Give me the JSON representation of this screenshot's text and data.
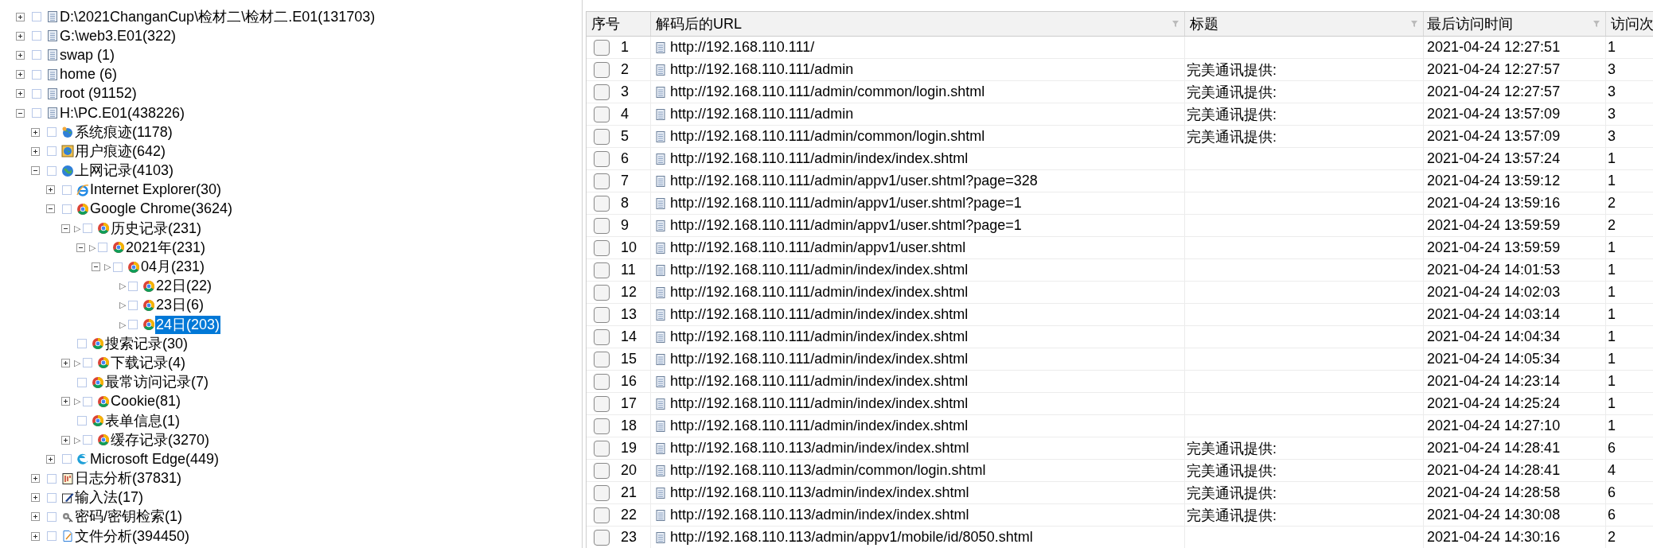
{
  "tree": {
    "items": [
      {
        "label": "D:\\2021ChanganCup\\检材二\\检材二.E01(131703)",
        "kind": "disk",
        "expanded": false,
        "checked": false,
        "selected": false
      },
      {
        "label": "G:\\web3.E01(322)",
        "kind": "disk",
        "expanded": false,
        "checked": false,
        "selected": false
      },
      {
        "label": "swap (1)",
        "kind": "disk",
        "expanded": false,
        "checked": false,
        "selected": false
      },
      {
        "label": "home (6)",
        "kind": "disk",
        "expanded": false,
        "checked": false,
        "selected": false
      },
      {
        "label": "root (91152)",
        "kind": "disk",
        "expanded": false,
        "checked": false,
        "selected": false
      },
      {
        "label": "H:\\PC.E01(438226)",
        "kind": "disk",
        "expanded": true,
        "checked": false,
        "selected": false,
        "children": [
          {
            "label": "系统痕迹(1178)",
            "kind": "system",
            "expanded": false,
            "checked": false,
            "selected": false
          },
          {
            "label": "用户痕迹(642)",
            "kind": "user",
            "expanded": false,
            "checked": false,
            "selected": false
          },
          {
            "label": "上网记录(4103)",
            "kind": "globe",
            "expanded": true,
            "checked": false,
            "selected": false,
            "children": [
              {
                "label": "Internet Explorer(30)",
                "kind": "ie",
                "expanded": false,
                "checked": false,
                "selected": false
              },
              {
                "label": "Google Chrome(3624)",
                "kind": "chrome",
                "expanded": true,
                "checked": false,
                "selected": false,
                "children": [
                  {
                    "label": "历史记录(231)",
                    "kind": "chrome",
                    "expanded": true,
                    "marker": "▷",
                    "checked": false,
                    "selected": false,
                    "children": [
                      {
                        "label": "2021年(231)",
                        "kind": "chrome",
                        "expanded": true,
                        "marker": "▷",
                        "checked": false,
                        "selected": false,
                        "children": [
                          {
                            "label": "04月(231)",
                            "kind": "chrome",
                            "expanded": true,
                            "marker": "▷",
                            "checked": false,
                            "selected": false,
                            "children": [
                              {
                                "label": "22日(22)",
                                "kind": "chrome",
                                "marker": "▷",
                                "checked": false,
                                "selected": false
                              },
                              {
                                "label": "23日(6)",
                                "kind": "chrome",
                                "marker": "▷",
                                "checked": false,
                                "selected": false
                              },
                              {
                                "label": "24日(203)",
                                "kind": "chrome",
                                "marker": "▷",
                                "checked": false,
                                "selected": true
                              }
                            ]
                          }
                        ]
                      }
                    ]
                  },
                  {
                    "label": "搜索记录(30)",
                    "kind": "chrome",
                    "checked": false,
                    "selected": false
                  },
                  {
                    "label": "下载记录(4)",
                    "kind": "chrome",
                    "expanded": false,
                    "marker": "▷",
                    "checked": false,
                    "selected": false
                  },
                  {
                    "label": "最常访问记录(7)",
                    "kind": "chrome",
                    "checked": false,
                    "selected": false
                  },
                  {
                    "label": "Cookie(81)",
                    "kind": "chrome",
                    "expanded": false,
                    "marker": "▷",
                    "checked": false,
                    "selected": false
                  },
                  {
                    "label": "表单信息(1)",
                    "kind": "chrome",
                    "checked": false,
                    "selected": false
                  },
                  {
                    "label": "缓存记录(3270)",
                    "kind": "chrome",
                    "expanded": false,
                    "marker": "▷",
                    "checked": false,
                    "selected": false
                  }
                ]
              },
              {
                "label": "Microsoft Edge(449)",
                "kind": "edge",
                "expanded": false,
                "checked": false,
                "selected": false
              }
            ]
          },
          {
            "label": "日志分析(37831)",
            "kind": "log",
            "expanded": false,
            "checked": false,
            "selected": false
          },
          {
            "label": "输入法(17)",
            "kind": "ime",
            "expanded": false,
            "checked": false,
            "selected": false
          },
          {
            "label": "密码/密钥检索(1)",
            "kind": "key",
            "expanded": false,
            "checked": false,
            "selected": false
          },
          {
            "label": "文件分析(394450)",
            "kind": "file",
            "expanded": false,
            "checked": false,
            "selected": false
          }
        ]
      }
    ]
  },
  "table": {
    "columns": [
      {
        "label": "序号",
        "filter": false
      },
      {
        "label": "解码后的URL",
        "filter": true
      },
      {
        "label": "标题",
        "filter": true
      },
      {
        "label": "最后访问时间",
        "filter": true
      },
      {
        "label": "访问次"
      }
    ],
    "rows": [
      {
        "checked": false,
        "no": "1",
        "url": "http://192.168.110.111/",
        "title": "",
        "time": "2021-04-24 12:27:51",
        "count": "1"
      },
      {
        "checked": false,
        "no": "2",
        "url": "http://192.168.110.111/admin",
        "title": "完美通讯提供:",
        "time": "2021-04-24 12:27:57",
        "count": "3"
      },
      {
        "checked": false,
        "no": "3",
        "url": "http://192.168.110.111/admin/common/login.shtml",
        "title": "完美通讯提供:",
        "time": "2021-04-24 12:27:57",
        "count": "3"
      },
      {
        "checked": false,
        "no": "4",
        "url": "http://192.168.110.111/admin",
        "title": "完美通讯提供:",
        "time": "2021-04-24 13:57:09",
        "count": "3"
      },
      {
        "checked": false,
        "no": "5",
        "url": "http://192.168.110.111/admin/common/login.shtml",
        "title": "完美通讯提供:",
        "time": "2021-04-24 13:57:09",
        "count": "3"
      },
      {
        "checked": false,
        "no": "6",
        "url": "http://192.168.110.111/admin/index/index.shtml",
        "title": "",
        "time": "2021-04-24 13:57:24",
        "count": "1"
      },
      {
        "checked": false,
        "no": "7",
        "url": "http://192.168.110.111/admin/appv1/user.shtml?page=328",
        "title": "",
        "time": "2021-04-24 13:59:12",
        "count": "1"
      },
      {
        "checked": false,
        "no": "8",
        "url": "http://192.168.110.111/admin/appv1/user.shtml?page=1",
        "title": "",
        "time": "2021-04-24 13:59:16",
        "count": "2"
      },
      {
        "checked": false,
        "no": "9",
        "url": "http://192.168.110.111/admin/appv1/user.shtml?page=1",
        "title": "",
        "time": "2021-04-24 13:59:59",
        "count": "2"
      },
      {
        "checked": false,
        "no": "10",
        "url": "http://192.168.110.111/admin/appv1/user.shtml",
        "title": "",
        "time": "2021-04-24 13:59:59",
        "count": "1"
      },
      {
        "checked": false,
        "no": "11",
        "url": "http://192.168.110.111/admin/index/index.shtml",
        "title": "",
        "time": "2021-04-24 14:01:53",
        "count": "1"
      },
      {
        "checked": false,
        "no": "12",
        "url": "http://192.168.110.111/admin/index/index.shtml",
        "title": "",
        "time": "2021-04-24 14:02:03",
        "count": "1"
      },
      {
        "checked": false,
        "no": "13",
        "url": "http://192.168.110.111/admin/index/index.shtml",
        "title": "",
        "time": "2021-04-24 14:03:14",
        "count": "1"
      },
      {
        "checked": false,
        "no": "14",
        "url": "http://192.168.110.111/admin/index/index.shtml",
        "title": "",
        "time": "2021-04-24 14:04:34",
        "count": "1"
      },
      {
        "checked": false,
        "no": "15",
        "url": "http://192.168.110.111/admin/index/index.shtml",
        "title": "",
        "time": "2021-04-24 14:05:34",
        "count": "1"
      },
      {
        "checked": false,
        "no": "16",
        "url": "http://192.168.110.111/admin/index/index.shtml",
        "title": "",
        "time": "2021-04-24 14:23:14",
        "count": "1"
      },
      {
        "checked": false,
        "no": "17",
        "url": "http://192.168.110.111/admin/index/index.shtml",
        "title": "",
        "time": "2021-04-24 14:25:24",
        "count": "1"
      },
      {
        "checked": false,
        "no": "18",
        "url": "http://192.168.110.111/admin/index/index.shtml",
        "title": "",
        "time": "2021-04-24 14:27:10",
        "count": "1"
      },
      {
        "checked": false,
        "no": "19",
        "url": "http://192.168.110.113/admin/index/index.shtml",
        "title": "完美通讯提供:",
        "time": "2021-04-24 14:28:41",
        "count": "6"
      },
      {
        "checked": false,
        "no": "20",
        "url": "http://192.168.110.113/admin/common/login.shtml",
        "title": "完美通讯提供:",
        "time": "2021-04-24 14:28:41",
        "count": "4"
      },
      {
        "checked": false,
        "no": "21",
        "url": "http://192.168.110.113/admin/index/index.shtml",
        "title": "完美通讯提供:",
        "time": "2021-04-24 14:28:58",
        "count": "6"
      },
      {
        "checked": false,
        "no": "22",
        "url": "http://192.168.110.113/admin/index/index.shtml",
        "title": "完美通讯提供:",
        "time": "2021-04-24 14:30:08",
        "count": "6"
      },
      {
        "checked": false,
        "no": "23",
        "url": "http://192.168.110.113/admin/appv1/mobile/id/8050.shtml",
        "title": "",
        "time": "2021-04-24 14:30:16",
        "count": "2"
      }
    ]
  }
}
